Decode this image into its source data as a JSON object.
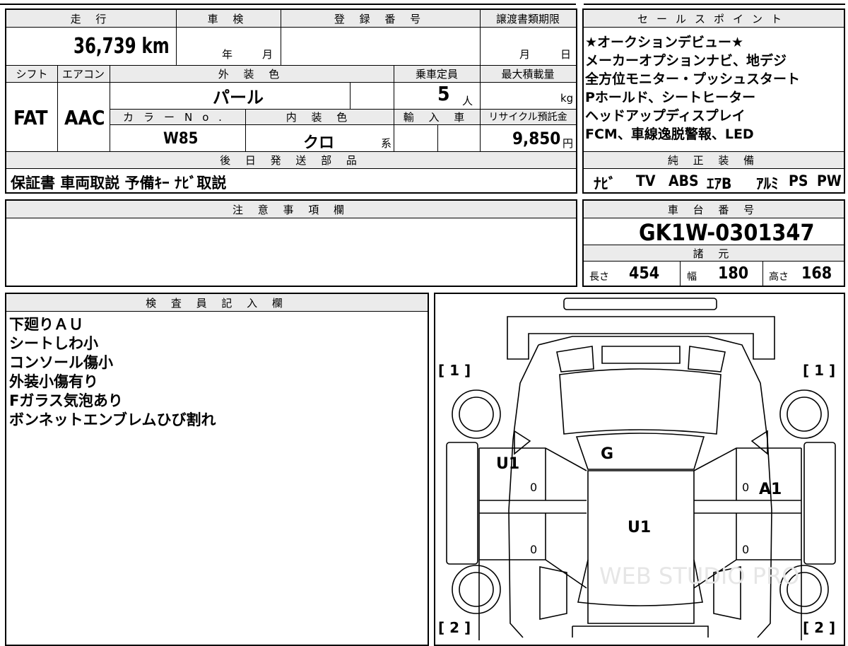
{
  "main_table": {
    "mileage_label": "走 行",
    "mileage_value": "36,739 km",
    "inspection_label": "車 検",
    "inspection_year": "年",
    "inspection_month": "月",
    "reg_label": "登 録 番 号",
    "transfer_label": "譲渡書類期限",
    "transfer_month": "月",
    "transfer_day": "日",
    "shift_label": "シフト",
    "ac_label": "エアコン",
    "ext_color_label": "外 装 色",
    "capacity_label": "乗車定員",
    "maxload_label": "最大積載量",
    "shift_value": "FAT",
    "ac_value": "AAC",
    "ext_color_value": "パール",
    "capacity_value": "5",
    "capacity_unit": "人",
    "maxload_unit": "kg",
    "color_no_label": "カラーNo.",
    "int_color_label": "内 装 色",
    "import_label": "輸 入 車",
    "recycle_label": "リサイクル預託金",
    "color_no_value": "W85",
    "int_color_value": "クロ",
    "int_color_suffix": "系",
    "recycle_value": "9,850",
    "recycle_unit": "円",
    "later_label": "後 日 発 送 部 品",
    "later_value": "保証書 車両取説 予備ｷｰ ﾅﾋﾞ取説"
  },
  "sales_points": {
    "label": "セールスポイント",
    "lines": [
      "★オークションデビュー★",
      "メーカーオプションナビ、地デジ",
      "全方位モニター・プッシュスタート",
      "Pホールド、シートヒーター",
      "ヘッドアップディスプレイ",
      "FCM、車線逸脱警報、LED"
    ]
  },
  "genuine": {
    "label": "純 正 装 備",
    "items": [
      "ﾅﾋﾞ",
      "TV",
      "ABS",
      "ｴｱB",
      "ｱﾙﾐ",
      "PS",
      "PW"
    ]
  },
  "notes": {
    "label": "注 意 事 項 欄"
  },
  "chassis": {
    "label": "車 台 番 号",
    "value": "GK1W-0301347",
    "spec_label": "諸 元",
    "length_label": "長さ",
    "length_value": "454",
    "width_label": "幅",
    "width_value": "180",
    "height_label": "高さ",
    "height_value": "168"
  },
  "inspector": {
    "label": "検 査 員 記 入 欄",
    "lines": [
      "下廻りＡＵ",
      "シートしわ小",
      "コンソール傷小",
      "外装小傷有り",
      "Fガラス気泡あり",
      "ボンネットエンブレムひび割れ"
    ]
  },
  "diagram": {
    "bracket_tl": "[ 1 ]",
    "bracket_tr": "[ 1 ]",
    "bracket_bl": "[ 2 ]",
    "bracket_br": "[ 2 ]",
    "mark_windshield": "G",
    "mark_left_front": "U1",
    "mark_right_front": "A1",
    "mark_roof": "U1",
    "zero1": "0",
    "zero2": "0",
    "zero3": "0",
    "zero4": "0",
    "watermark": "WEB STUDIO PRO"
  },
  "colors": {
    "header_bg": "#ebebeb",
    "line": "#000000"
  }
}
